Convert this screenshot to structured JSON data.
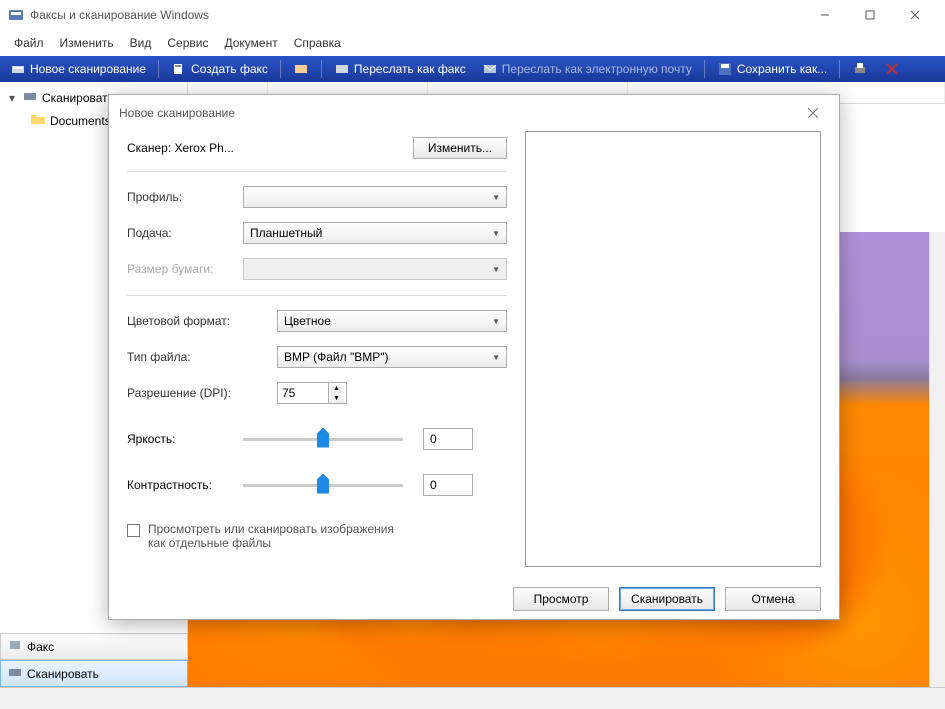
{
  "window": {
    "title": "Факсы и сканирование Windows"
  },
  "menu": {
    "file": "Файл",
    "edit": "Изменить",
    "view": "Вид",
    "tools": "Сервис",
    "document": "Документ",
    "help": "Справка"
  },
  "toolbar": {
    "new_scan": "Новое сканирование",
    "create_fax": "Создать факс",
    "forward_as_fax": "Переслать как факс",
    "forward_as_email": "Переслать как электронную почту",
    "save_as": "Сохранить как..."
  },
  "tree": {
    "root": "Сканировать",
    "folder": "Documents"
  },
  "bottom_tabs": {
    "fax": "Факс",
    "scan": "Сканировать"
  },
  "dialog": {
    "title": "Новое сканирование",
    "scanner_label": "Сканер: Xerox Ph...",
    "change_btn": "Изменить...",
    "profile_label": "Профиль:",
    "profile_value": "",
    "source_label": "Подача:",
    "source_value": "Планшетный",
    "paper_label": "Размер бумаги:",
    "paper_value": "",
    "color_label": "Цветовой формат:",
    "color_value": "Цветное",
    "filetype_label": "Тип файла:",
    "filetype_value": "BMP (Файл \"BMP\")",
    "resolution_label": "Разрешение (DPI):",
    "resolution_value": "75",
    "brightness_label": "Яркость:",
    "brightness_value": "0",
    "contrast_label": "Контрастность:",
    "contrast_value": "0",
    "checkbox_label": "Просмотреть или сканировать изображения как отдельные файлы",
    "preview_btn": "Просмотр",
    "scan_btn": "Сканировать",
    "cancel_btn": "Отмена"
  }
}
